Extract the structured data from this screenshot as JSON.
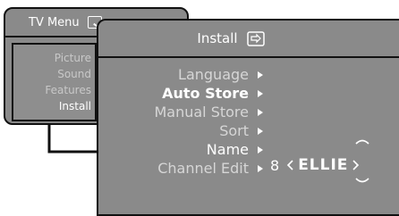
{
  "tv_menu": {
    "title": "TV Menu",
    "items": [
      {
        "label": "Picture",
        "active": false
      },
      {
        "label": "Sound",
        "active": false
      },
      {
        "label": "Features",
        "active": false
      },
      {
        "label": "Install",
        "active": true
      }
    ]
  },
  "install_menu": {
    "title": "Install",
    "items": [
      {
        "label": "Language",
        "state": "normal"
      },
      {
        "label": "Auto Store",
        "state": "selected"
      },
      {
        "label": "Manual Store",
        "state": "normal"
      },
      {
        "label": "Sort",
        "state": "normal"
      },
      {
        "label": "Name",
        "state": "focused"
      },
      {
        "label": "Channel Edit",
        "state": "normal"
      }
    ]
  },
  "name_editor": {
    "channel_number": "8",
    "name_value": "ELLIE"
  },
  "colors": {
    "panel_background": "#8a8a8a",
    "border": "#111111",
    "text_active": "#ffffff",
    "text_inactive": "#d6d6d6"
  },
  "icons": {
    "tv_menu_icon": "tv-menu-icon",
    "install_icon": "install-icon",
    "submenu_arrow": "arrow-right-icon",
    "nav_left": "nav-left-icon",
    "nav_right": "nav-right-icon",
    "nav_up": "nav-up-icon",
    "nav_down": "nav-down-icon"
  }
}
